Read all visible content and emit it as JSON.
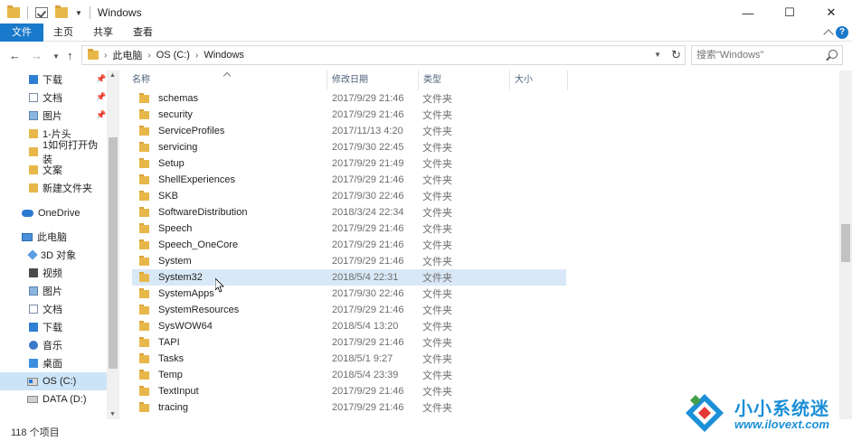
{
  "window": {
    "title": "Windows",
    "buttons": {
      "minimize": "—",
      "maximize": "☐",
      "close": "✕"
    }
  },
  "ribbon": {
    "tabs": [
      {
        "label": "文件"
      },
      {
        "label": "主页"
      },
      {
        "label": "共享"
      },
      {
        "label": "查看"
      }
    ],
    "help": "?"
  },
  "address": {
    "crumbs": [
      "此电脑",
      "OS (C:)",
      "Windows"
    ],
    "search_placeholder": "搜索\"Windows\""
  },
  "nav_pane": {
    "items": [
      {
        "label": "下载",
        "icon": "download-folder-icon",
        "pinned": true
      },
      {
        "label": "文档",
        "icon": "document-folder-icon",
        "pinned": true
      },
      {
        "label": "图片",
        "icon": "pictures-folder-icon",
        "pinned": true
      },
      {
        "label": "1-片头",
        "icon": "folder-icon",
        "pinned": false
      },
      {
        "label": "1如何打开伪装",
        "icon": "folder-icon",
        "pinned": false
      },
      {
        "label": "文案",
        "icon": "folder-icon",
        "pinned": false
      },
      {
        "label": "新建文件夹",
        "icon": "folder-icon",
        "pinned": false
      },
      {
        "label": "OneDrive",
        "icon": "onedrive-cloud-icon"
      },
      {
        "label": "此电脑",
        "icon": "this-pc-icon"
      },
      {
        "label": "3D 对象",
        "icon": "3d-objects-icon"
      },
      {
        "label": "视频",
        "icon": "videos-icon"
      },
      {
        "label": "图片",
        "icon": "pictures-icon"
      },
      {
        "label": "文档",
        "icon": "documents-icon"
      },
      {
        "label": "下载",
        "icon": "downloads-icon"
      },
      {
        "label": "音乐",
        "icon": "music-icon"
      },
      {
        "label": "桌面",
        "icon": "desktop-icon"
      },
      {
        "label": "OS (C:)",
        "icon": "os-drive-icon",
        "selected": true
      },
      {
        "label": "DATA (D:)",
        "icon": "data-drive-icon"
      }
    ]
  },
  "columns": {
    "name": "名称",
    "date": "修改日期",
    "type": "类型",
    "size": "大小"
  },
  "files": [
    {
      "name": "schemas",
      "date": "2017/9/29 21:46",
      "type": "文件夹"
    },
    {
      "name": "security",
      "date": "2017/9/29 21:46",
      "type": "文件夹"
    },
    {
      "name": "ServiceProfiles",
      "date": "2017/11/13 4:20",
      "type": "文件夹"
    },
    {
      "name": "servicing",
      "date": "2017/9/30 22:45",
      "type": "文件夹"
    },
    {
      "name": "Setup",
      "date": "2017/9/29 21:49",
      "type": "文件夹"
    },
    {
      "name": "ShellExperiences",
      "date": "2017/9/29 21:46",
      "type": "文件夹"
    },
    {
      "name": "SKB",
      "date": "2017/9/30 22:46",
      "type": "文件夹"
    },
    {
      "name": "SoftwareDistribution",
      "date": "2018/3/24 22:34",
      "type": "文件夹"
    },
    {
      "name": "Speech",
      "date": "2017/9/29 21:46",
      "type": "文件夹"
    },
    {
      "name": "Speech_OneCore",
      "date": "2017/9/29 21:46",
      "type": "文件夹"
    },
    {
      "name": "System",
      "date": "2017/9/29 21:46",
      "type": "文件夹"
    },
    {
      "name": "System32",
      "date": "2018/5/4 22:31",
      "type": "文件夹",
      "hover": true
    },
    {
      "name": "SystemApps",
      "date": "2017/9/30 22:46",
      "type": "文件夹"
    },
    {
      "name": "SystemResources",
      "date": "2017/9/29 21:46",
      "type": "文件夹"
    },
    {
      "name": "SysWOW64",
      "date": "2018/5/4 13:20",
      "type": "文件夹"
    },
    {
      "name": "TAPI",
      "date": "2017/9/29 21:46",
      "type": "文件夹"
    },
    {
      "name": "Tasks",
      "date": "2018/5/1 9:27",
      "type": "文件夹"
    },
    {
      "name": "Temp",
      "date": "2018/5/4 23:39",
      "type": "文件夹"
    },
    {
      "name": "TextInput",
      "date": "2017/9/29 21:46",
      "type": "文件夹"
    },
    {
      "name": "tracing",
      "date": "2017/9/29 21:46",
      "type": "文件夹"
    }
  ],
  "status": {
    "count": "118 个项目"
  },
  "watermark": {
    "title": "小小系统迷",
    "url": "www.ilovext.com"
  }
}
